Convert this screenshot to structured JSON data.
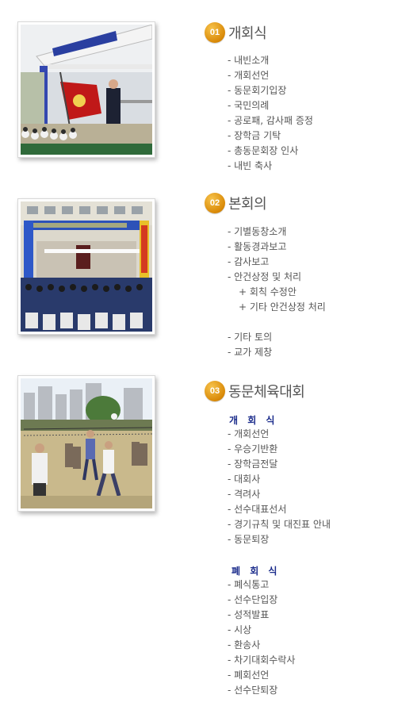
{
  "sections": [
    {
      "number": "01",
      "title": "개회식",
      "items": [
        "- 내빈소개",
        "- 개회선언",
        "- 동문회기입장",
        "- 국민의례",
        "- 공로패, 감사패 증정",
        "- 장학금 기탁",
        "- 총동문회장 인사",
        "- 내빈 축사"
      ]
    },
    {
      "number": "02",
      "title": "본회의",
      "items": [
        "- 기별동창소개",
        "- 활동경과보고",
        "- 감사보고",
        "- 안건상정 및 처리"
      ],
      "subitems": [
        "+ 회칙 수정안",
        "+ 기타 안건상정 처리"
      ],
      "items2": [
        "- 기타 토의",
        "- 교가 제창"
      ]
    },
    {
      "number": "03",
      "title": "동문체육대회",
      "opening_label": "개 회 식",
      "opening_items": [
        "- 개회선언",
        "- 우승기반환",
        "- 장학금전달",
        "- 대회사",
        "- 격려사",
        "- 선수대표선서",
        "- 경기규칙 및 대진표 안내",
        "- 동문퇴장"
      ],
      "closing_label": "폐 회 식",
      "closing_items": [
        "- 폐식통고",
        "- 선수단입장",
        "- 성적발표",
        "- 시상",
        "- 환송사",
        "- 차기대회수락사",
        "- 폐회선언",
        "- 선수단퇴장"
      ]
    }
  ]
}
